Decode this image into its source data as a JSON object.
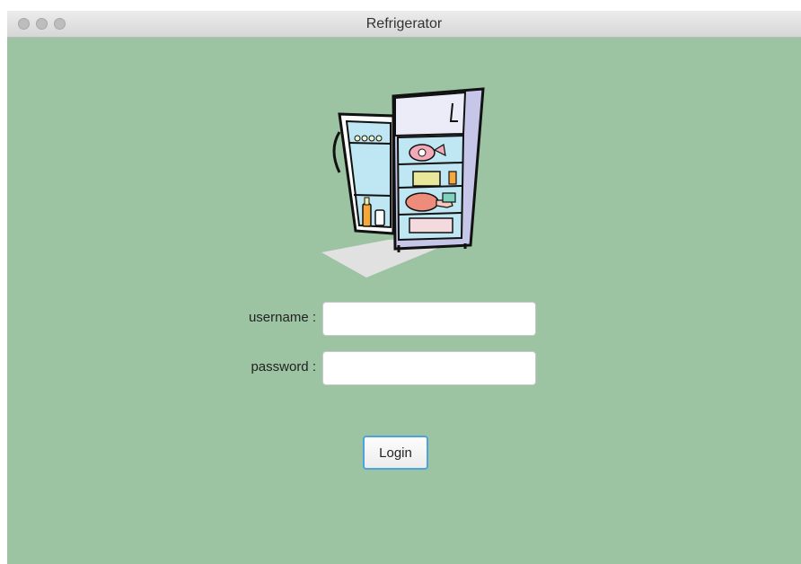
{
  "window": {
    "title": "Refrigerator"
  },
  "form": {
    "username_label": "username :",
    "username_value": "",
    "password_label": "password :",
    "password_value": "",
    "login_label": "Login"
  },
  "colors": {
    "window_background": "#9cc4a3",
    "button_focus_ring": "#4fa3d8"
  },
  "icons": {
    "illustration": "refrigerator-illustration"
  }
}
